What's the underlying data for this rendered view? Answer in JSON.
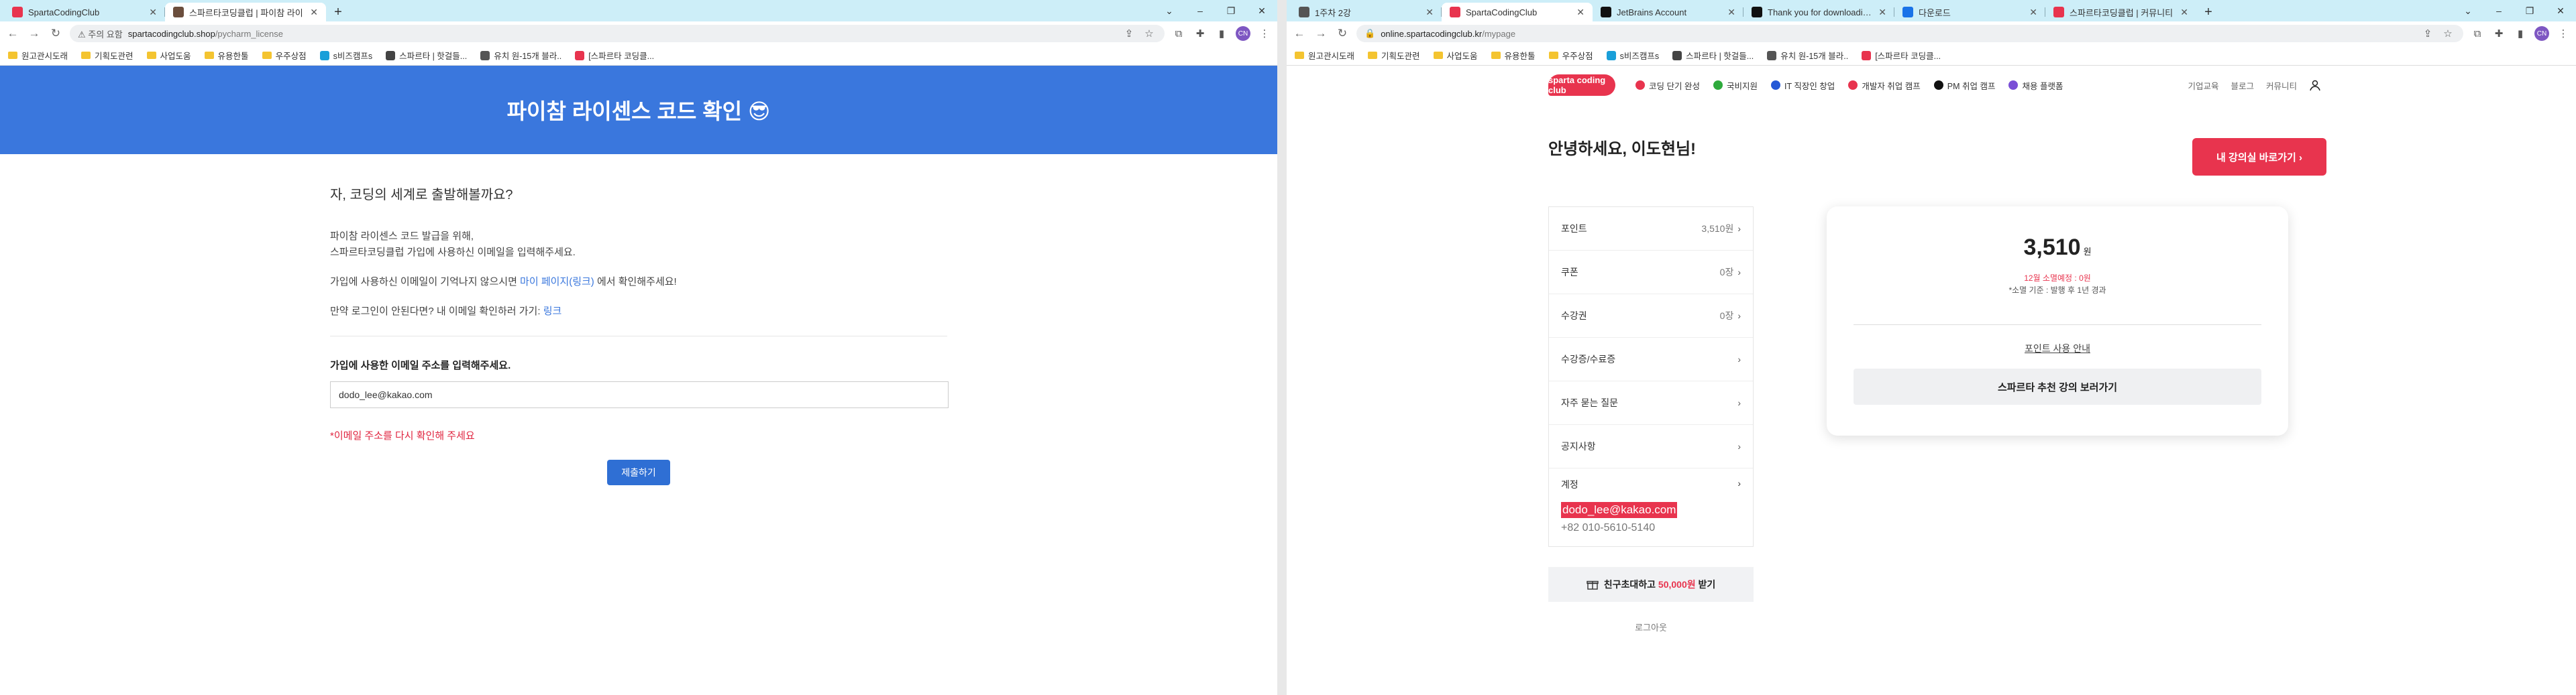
{
  "left": {
    "tabs": [
      {
        "title": "SpartaCodingClub",
        "favicon_color": "#e8344e",
        "active": false
      },
      {
        "title": "스파르타코딩클럽 | 파이참 라이",
        "favicon_color": "#6b4e3d",
        "active": true
      }
    ],
    "new_tab": "+",
    "window_controls": [
      "⌄",
      "–",
      "❐",
      "✕"
    ],
    "omnibox": {
      "warning": "⚠ 주의 요함",
      "host": "spartacodingclub.shop",
      "path": "/pycharm_license"
    },
    "profile_initials": "CN",
    "bookmarks": [
      {
        "label": "원고관시도래",
        "type": "folder"
      },
      {
        "label": "기획도관련",
        "type": "folder"
      },
      {
        "label": "사업도움",
        "type": "folder"
      },
      {
        "label": "유용한툴",
        "type": "folder"
      },
      {
        "label": "우주상점",
        "type": "folder"
      },
      {
        "label": "s비즈캠프s",
        "type": "site",
        "color": "#1a9fd9"
      },
      {
        "label": "스파르타 | 핫걸들...",
        "type": "site",
        "color": "#444444"
      },
      {
        "label": "유치 원-15개 블라..",
        "type": "site",
        "color": "#555555"
      },
      {
        "label": "[스파르타 코딩클...",
        "type": "site",
        "color": "#e8344e"
      }
    ],
    "page": {
      "header": "파이참 라이센스 코드 확인 😎",
      "question": "자, 코딩의 세계로 출발해볼까요?",
      "para1_line1": "파이참 라이센스 코드 발급을 위해,",
      "para1_line2": "스파르타코딩클럽 가입에 사용하신 이메일을 입력해주세요.",
      "para2_prefix": "가입에 사용하신 이메일이 기억나지 않으시면 ",
      "para2_link": "마이 페이지(링크)",
      "para2_suffix": " 에서 확인해주세요!",
      "para3_prefix": "만약 로그인이 안된다면? 내 이메일 확인하러 가기: ",
      "para3_link": "링크",
      "email_label": "가입에 사용한 이메일 주소를 입력해주세요.",
      "email_value": "dodo_lee@kakao.com",
      "error": "*이메일 주소를 다시 확인해 주세요",
      "submit": "제출하기"
    }
  },
  "right": {
    "tabs": [
      {
        "title": "1주차 2강",
        "favicon_color": "#555555",
        "active": false
      },
      {
        "title": "SpartaCodingClub",
        "favicon_color": "#e8344e",
        "active": true
      },
      {
        "title": "JetBrains Account",
        "favicon_color": "#111111",
        "active": false
      },
      {
        "title": "Thank you for downloading Py",
        "favicon_color": "#111111",
        "active": false
      },
      {
        "title": "다운로드",
        "favicon_color": "#1a73e8",
        "active": false
      },
      {
        "title": "스파르타코딩클럽 | 커뮤니티",
        "favicon_color": "#e8344e",
        "active": false
      }
    ],
    "new_tab": "+",
    "window_controls": [
      "⌄",
      "–",
      "❐",
      "✕"
    ],
    "omnibox": {
      "host": "online.spartacodingclub.kr",
      "path": "/mypage"
    },
    "profile_initials": "CN",
    "bookmarks": [
      {
        "label": "원고관시도래",
        "type": "folder"
      },
      {
        "label": "기획도관련",
        "type": "folder"
      },
      {
        "label": "사업도움",
        "type": "folder"
      },
      {
        "label": "유용한툴",
        "type": "folder"
      },
      {
        "label": "우주상점",
        "type": "folder"
      },
      {
        "label": "s비즈캠프s",
        "type": "site",
        "color": "#1a9fd9"
      },
      {
        "label": "스파르타 | 핫걸들...",
        "type": "site",
        "color": "#444444"
      },
      {
        "label": "유치 원-15개 블라..",
        "type": "site",
        "color": "#555555"
      },
      {
        "label": "[스파르타 코딩클...",
        "type": "site",
        "color": "#e8344e"
      }
    ],
    "site_nav": {
      "logo": "sparta coding club",
      "items": [
        {
          "label": "코딩 단기 완성",
          "color": "#e8344e"
        },
        {
          "label": "국비지원",
          "color": "#2eaa3c"
        },
        {
          "label": "IT 직장인 창업",
          "color": "#2458d6"
        },
        {
          "label": "개발자 취업 캠프",
          "color": "#e8344e"
        },
        {
          "label": "PM 취업 캠프",
          "color": "#111111"
        },
        {
          "label": "채용 플랫폼",
          "color": "#7a4fd6"
        }
      ],
      "right_links": [
        "기업교육",
        "블로그",
        "커뮤니티"
      ]
    },
    "mypage": {
      "greeting": "안녕하세요, 이도현님!",
      "cta": "내 강의실 바로가기 ›",
      "menu": [
        {
          "label": "포인트",
          "value": "3,510원"
        },
        {
          "label": "쿠폰",
          "value": "0장"
        },
        {
          "label": "수강권",
          "value": "0장"
        },
        {
          "label": "수강증/수료증",
          "value": ""
        },
        {
          "label": "자주 묻는 질문",
          "value": ""
        },
        {
          "label": "공지사항",
          "value": ""
        }
      ],
      "account_label": "계정",
      "account_email": "dodo_lee@kakao.com",
      "account_phone": "+82 010-5610-5140",
      "invite_prefix": "친구초대하고 ",
      "invite_amount": "50,000원",
      "invite_suffix": " 받기",
      "logout": "로그아웃",
      "card": {
        "points": "3,510",
        "unit": "원",
        "expire": "12월 소멸예정 : 0원",
        "note": "*소멸 기준 : 발행 후 1년 경과",
        "guide": "포인트 사용 안내",
        "recommend": "스파르타 추천 강의 보러가기"
      }
    }
  }
}
